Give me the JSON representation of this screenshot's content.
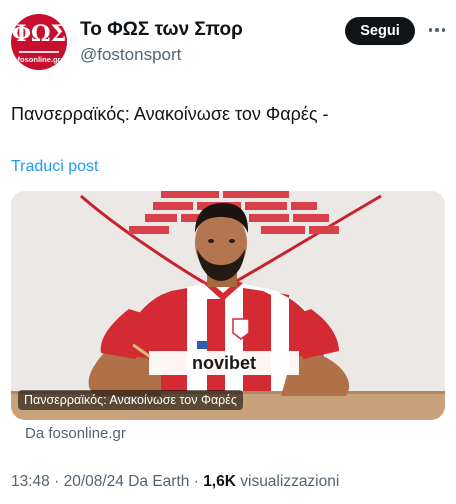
{
  "profile": {
    "display_name": "Το ΦΩΣ των Σπορ",
    "handle": "@fostonsport",
    "avatar_logo_text": "ΦΩΣ",
    "avatar_logo_url": "fosonline.gr"
  },
  "actions": {
    "follow_label": "Segui",
    "more_icon": "more-horizontal-icon"
  },
  "tweet": {
    "text": "Πανσερραϊκός: Ανακοίνωσε τον Φαρές  -",
    "translate_label": "Traduci post"
  },
  "link_card": {
    "image_caption": "Πανσερραϊκός: Ανακοίνωσε τον Φαρές",
    "source": "Da fosonline.gr",
    "jersey_sponsor": "novibet"
  },
  "meta": {
    "time": "13:48",
    "separator1": " · ",
    "date": "20/08/24",
    "source_text": " Da Earth",
    "separator2": " · ",
    "views_count": "1,6K",
    "views_label": " visualizzazioni"
  },
  "colors": {
    "accent": "#1d9bf0",
    "button_bg": "#0f1419",
    "brand_red": "#c8102e",
    "secondary_text": "#536471"
  }
}
